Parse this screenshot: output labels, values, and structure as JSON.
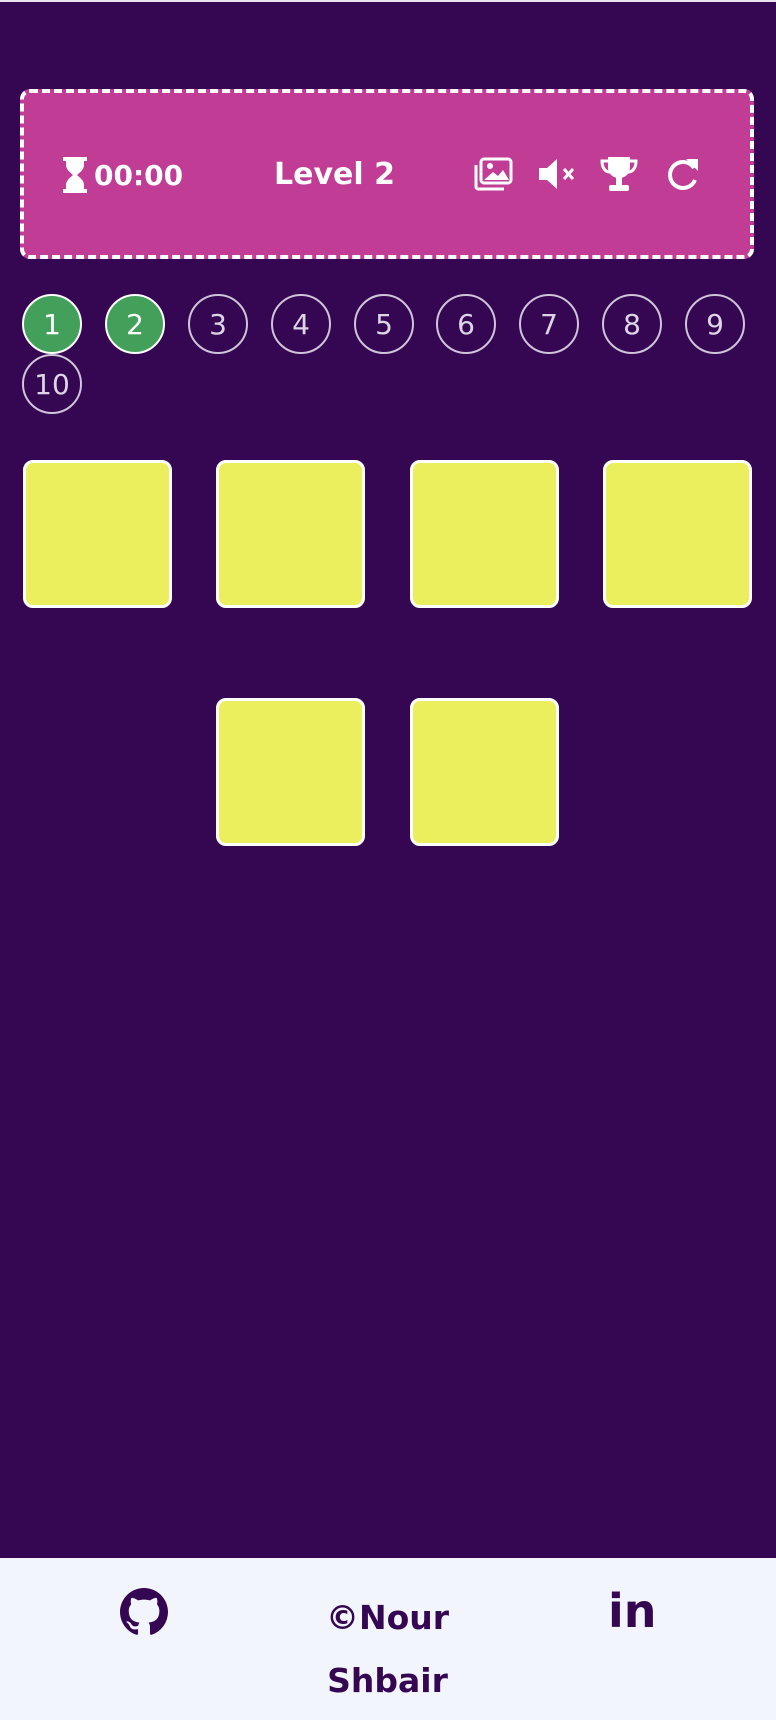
{
  "header": {
    "timer": "00:00",
    "level_label": "Level 2",
    "icons": [
      "image-icon",
      "mute-icon",
      "trophy-icon",
      "restart-icon"
    ]
  },
  "levels": {
    "items": [
      "1",
      "2",
      "3",
      "4",
      "5",
      "6",
      "7",
      "8",
      "9",
      "10"
    ],
    "completed": 2
  },
  "cards": {
    "count": 6,
    "state": "face-down"
  },
  "footer": {
    "credit": "©Nour Shbair",
    "linkedin": "in"
  },
  "colors": {
    "background": "#350752",
    "header": "#c03c95",
    "card": "#ebef5e",
    "completed_level": "#43a05a",
    "footer": "#f3f5fd"
  }
}
